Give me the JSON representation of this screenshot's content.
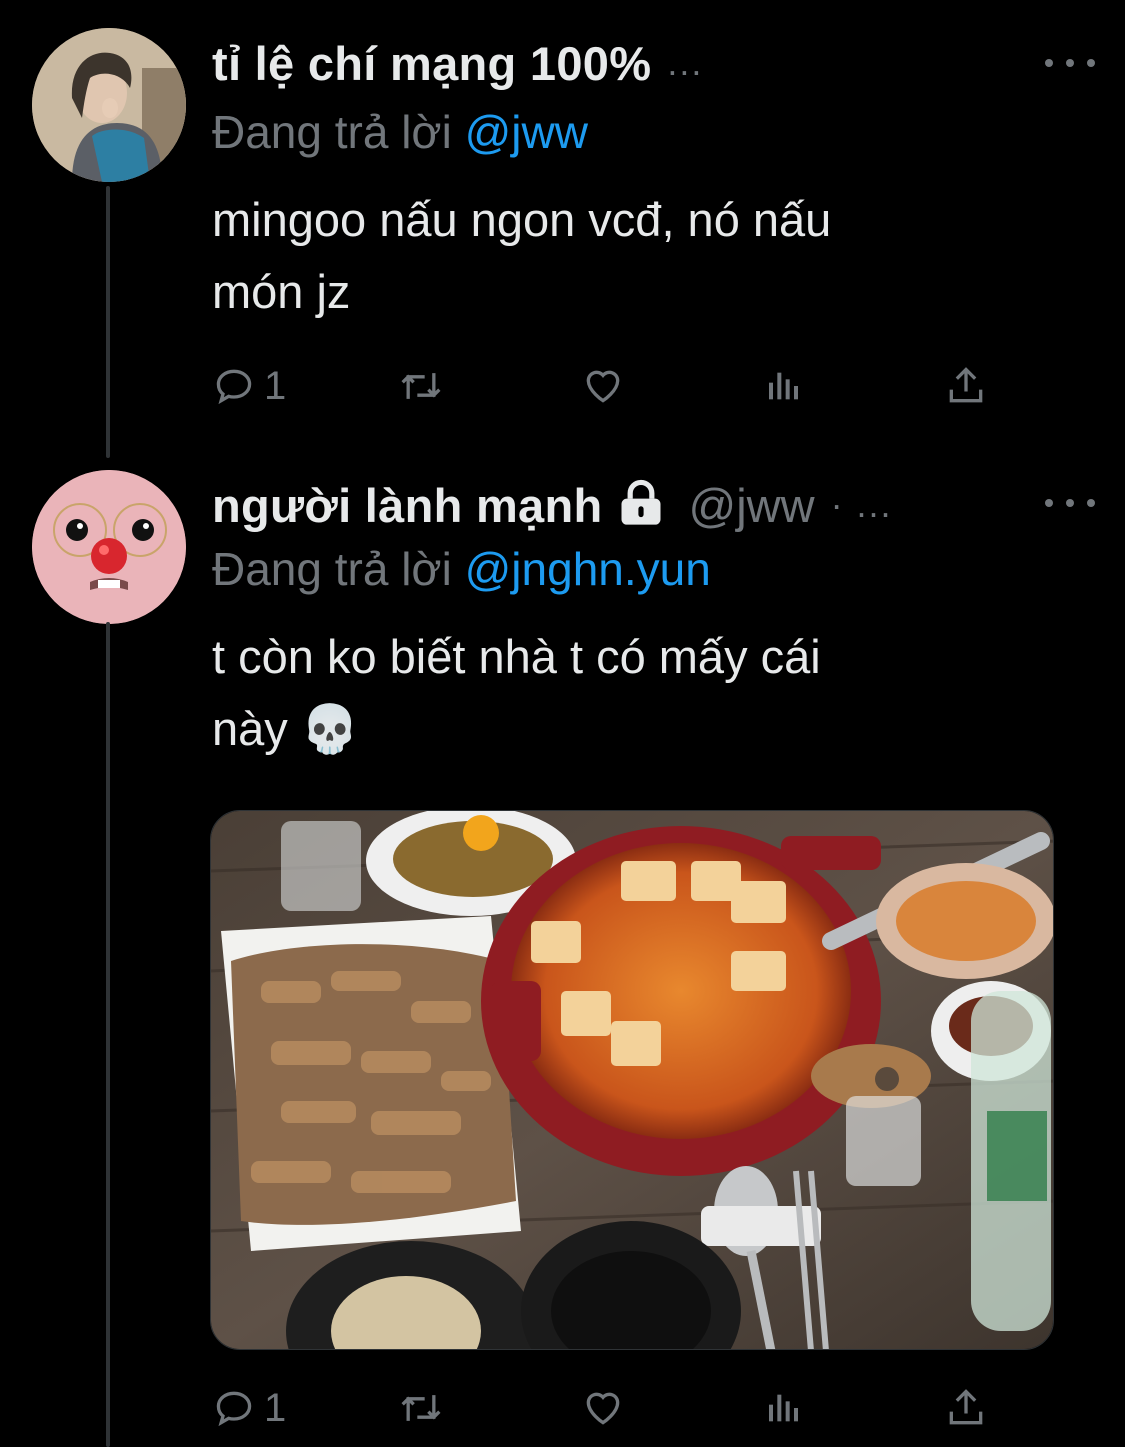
{
  "tweets": [
    {
      "display_name": "tỉ lệ chí mạng 100%",
      "handle": "",
      "truncation": "...",
      "replying_prefix": "Đang trả lời",
      "replying_to": "@jww",
      "text_lines": [
        "mingoo nấu ngon vcđ, nó nấu",
        "món jz"
      ],
      "reply_count": "1",
      "avatar": "person-photo"
    },
    {
      "display_name": "người lành mạnh",
      "locked": true,
      "handle": "@jww",
      "truncation": "· ...",
      "replying_prefix": "Đang trả lời",
      "replying_to": "@jnghn.yun",
      "text_lines": [
        "t còn ko biết nhà t có mấy cái",
        "này 💀"
      ],
      "reply_count": "1",
      "avatar": "pink-plush-face",
      "media": "photo of korean dinner table with stew and pork"
    }
  ],
  "icons": {
    "reply": "comment-icon",
    "retweet": "retweet-icon",
    "like": "heart-icon",
    "views": "analytics-icon",
    "share": "share-icon",
    "more": "more-icon",
    "lock": "lock-icon"
  },
  "colors": {
    "background": "#000000",
    "text": "#e7e9ea",
    "muted": "#71767b",
    "link": "#1d9bf0"
  }
}
